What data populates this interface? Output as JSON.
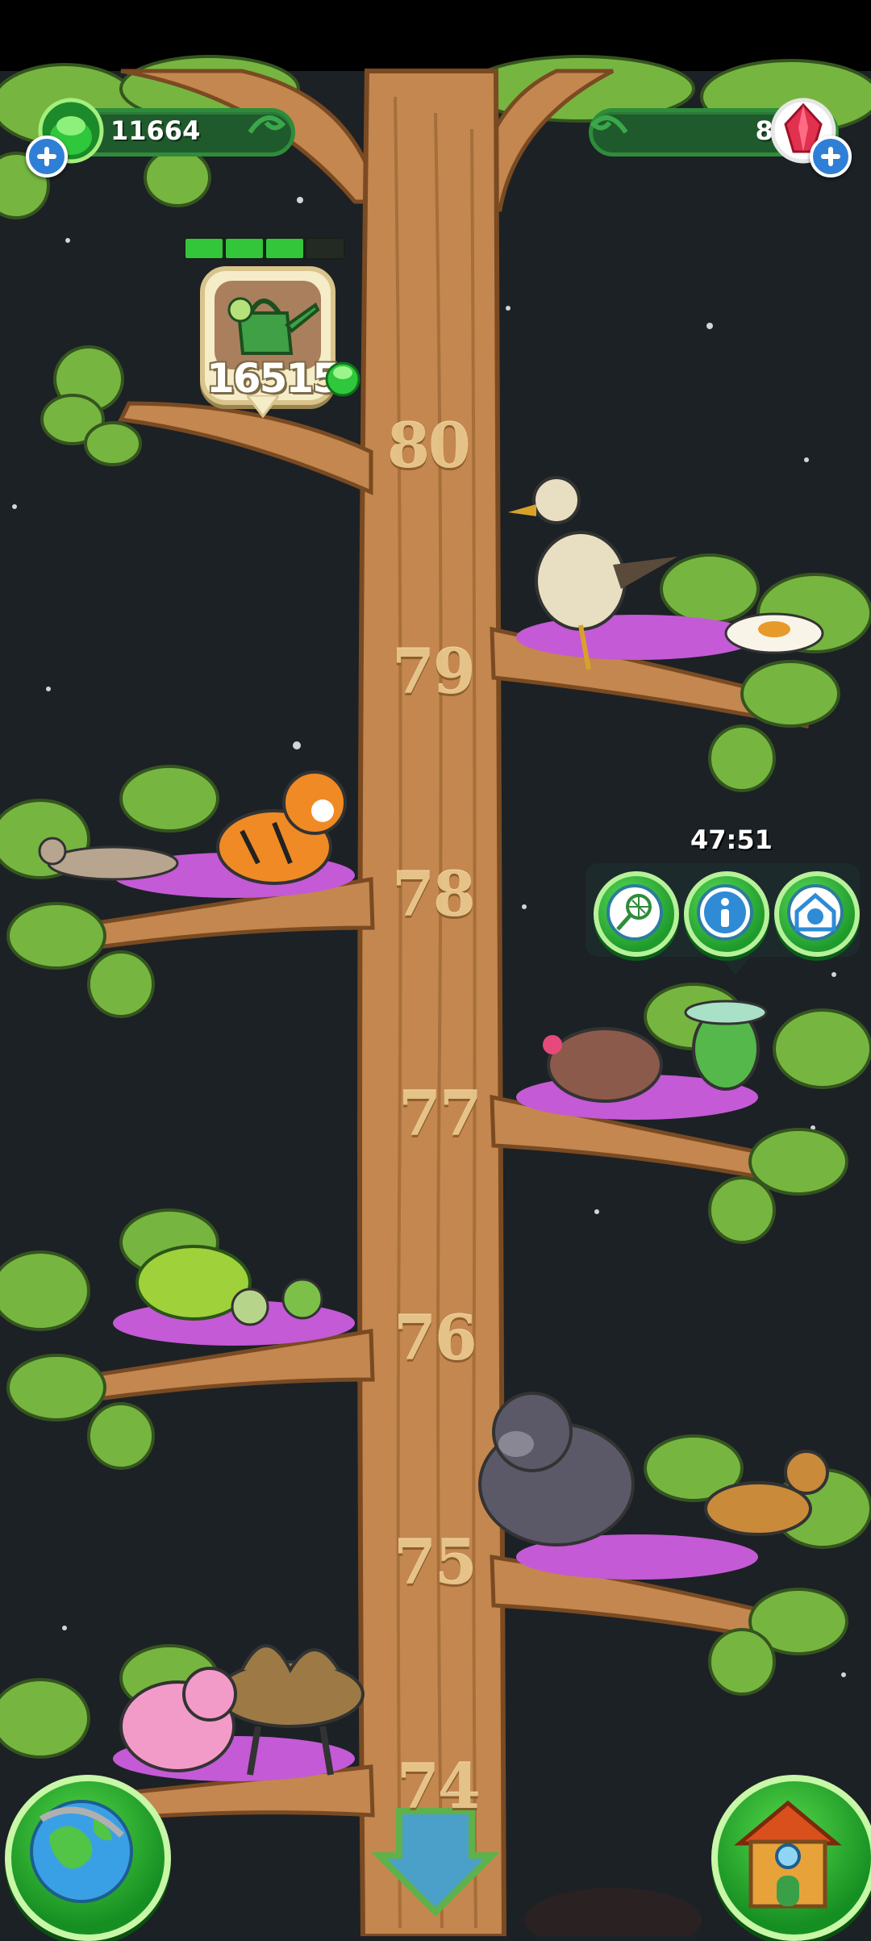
{
  "hud": {
    "gems_green": "11664",
    "gems_red": "80",
    "watering_cost": "16515",
    "watering_progress_fraction": 0.75,
    "timer": "47:51"
  },
  "tree": {
    "levels": [
      "80",
      "79",
      "78",
      "77",
      "76",
      "75",
      "74"
    ]
  },
  "icons": {
    "green_gem": "green-gem-icon",
    "red_gem": "red-gem-icon",
    "watering_can": "watering-can-icon",
    "net": "net-icon",
    "info": "info-icon",
    "home": "animal-home-icon",
    "globe": "globe-icon",
    "house": "house-icon",
    "scroll_down": "down-arrow-icon"
  },
  "colors": {
    "accent_green": "#2f8c3a",
    "trunk": "#c3874f",
    "leaf": "#76b640",
    "nest_pink": "#c45ad6"
  }
}
